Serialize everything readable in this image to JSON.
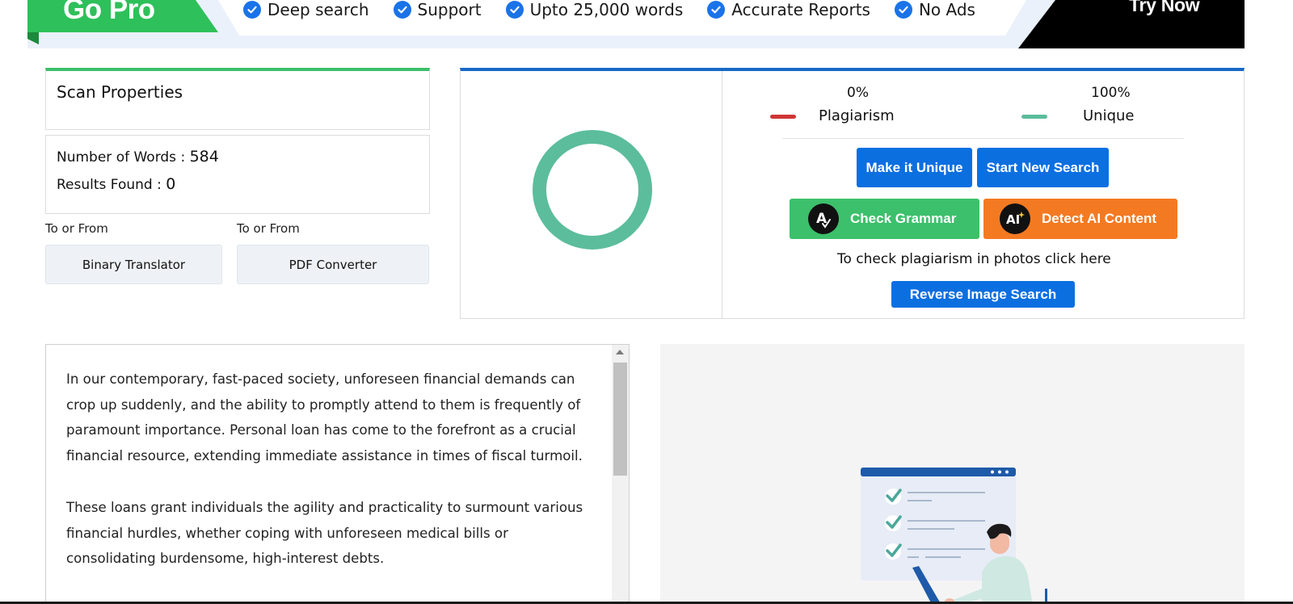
{
  "banner": {
    "go_pro": "Go Pro",
    "features": [
      "Deep search",
      "Support",
      "Upto 25,000 words",
      "Accurate Reports",
      "No Ads"
    ],
    "try_now": "Try Now"
  },
  "scan_properties": {
    "title": "Scan Properties",
    "words_label": "Number of Words :",
    "words_value": "584",
    "results_label": "Results Found :",
    "results_value": "0"
  },
  "tools": [
    {
      "caption": "To or From",
      "label": "Binary Translator"
    },
    {
      "caption": "To or From",
      "label": "PDF Converter"
    }
  ],
  "results": {
    "plagiarism_percent": "0%",
    "unique_percent": "100%",
    "plagiarism_label": "Plagiarism",
    "unique_label": "Unique",
    "make_unique": "Make it Unique",
    "start_new": "Start New Search",
    "check_grammar": "Check Grammar",
    "detect_ai": "Detect AI Content",
    "photo_note": "To check plagiarism in photos click here",
    "reverse_image": "Reverse Image Search",
    "unique_fraction": 1.0
  },
  "text": {
    "paragraphs": [
      "In our contemporary, fast-paced society, unforeseen financial demands can crop up suddenly, and the ability to promptly attend to them is frequently of paramount importance. Personal loan has come to the forefront as a crucial financial resource, extending immediate assistance in times of fiscal turmoil.",
      "These loans grant individuals the agility and practicality to surmount various financial hurdles, whether coping with unforeseen medical bills or consolidating burdensome, high-interest debts."
    ]
  },
  "colors": {
    "green": "#3cc06b",
    "blue": "#0b6fe0",
    "orange": "#f47a22",
    "unique_ring": "#5bbd9c",
    "plagiarism_red": "#d03535"
  }
}
